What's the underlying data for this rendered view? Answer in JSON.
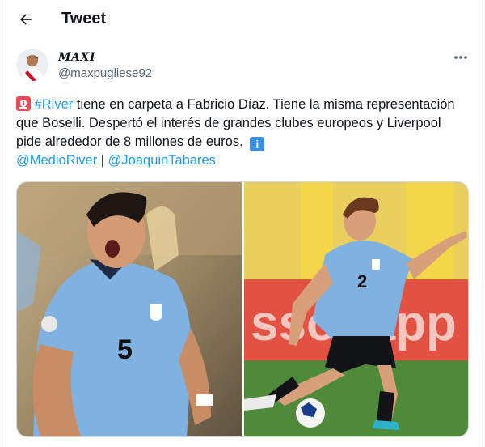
{
  "header": {
    "title": "Tweet",
    "back_icon": "arrow-left-icon"
  },
  "author": {
    "name": "MAXI",
    "handle": "@maxpugliese92",
    "avatar_icon": "user-avatar",
    "more_icon": "more-horizontal-icon"
  },
  "tweet": {
    "siren_icon": "police-light-emoji",
    "hashtag": "#River",
    "text_part1": " tiene en carpeta a Fabricio Díaz. Tiene la misma representación que Boselli. Despertó el interés de grandes clubes europeos y Liverpool pide alrededor de 8 millones de euros. ",
    "info_icon": "information-emoji",
    "info_glyph": "i",
    "mention1": "@MedioRiver",
    "separator": " | ",
    "mention2": "@JoaquinTabares"
  },
  "media": {
    "left_photo": {
      "shirt_number": "5"
    },
    "right_photo": {
      "shirt_number": "2",
      "banner_text": "ssonapp"
    }
  },
  "colors": {
    "link": "#1d9bf0",
    "text": "#0f1419",
    "secondary": "#536471",
    "uruguay_blue": "#7fb2e0"
  }
}
